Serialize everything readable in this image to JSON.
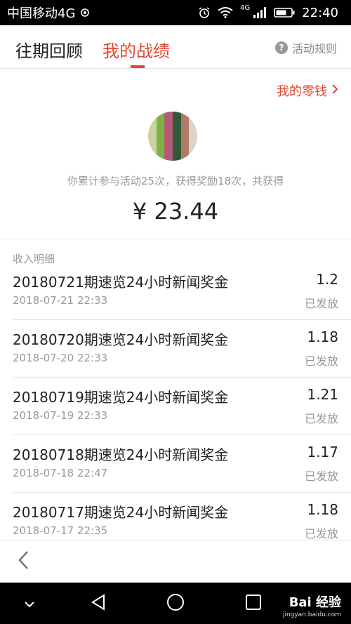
{
  "status_bar": {
    "carrier": "中国移动4G",
    "network": "4G",
    "time": "22:40"
  },
  "tabs": {
    "past": "往期回顾",
    "mine": "我的战绩",
    "rules": "活动规则",
    "rules_icon": "question-icon"
  },
  "summary": {
    "wallet_link": "我的零钱",
    "stats_text": "你累计参与活动25次，获得奖励18次，共获得",
    "total": "¥ 23.44"
  },
  "income": {
    "label": "收入明细",
    "items": [
      {
        "title": "20180721期速览24小时新闻奖金",
        "amount": "1.2",
        "date": "2018-07-21 22:33",
        "status": "已发放"
      },
      {
        "title": "20180720期速览24小时新闻奖金",
        "amount": "1.18",
        "date": "2018-07-20 22:33",
        "status": "已发放"
      },
      {
        "title": "20180719期速览24小时新闻奖金",
        "amount": "1.21",
        "date": "2018-07-19 22:33",
        "status": "已发放"
      },
      {
        "title": "20180718期速览24小时新闻奖金",
        "amount": "1.17",
        "date": "2018-07-18 22:47",
        "status": "已发放"
      },
      {
        "title": "20180717期速览24小时新闻奖金",
        "amount": "1.18",
        "date": "2018-07-17 22:35",
        "status": "已发放"
      }
    ]
  },
  "watermark": {
    "brand": "Bai 经验",
    "url": "jingyan.baidu.com"
  },
  "colors": {
    "accent": "#e6452e",
    "muted": "#999999",
    "divider": "#e5e5e5"
  }
}
